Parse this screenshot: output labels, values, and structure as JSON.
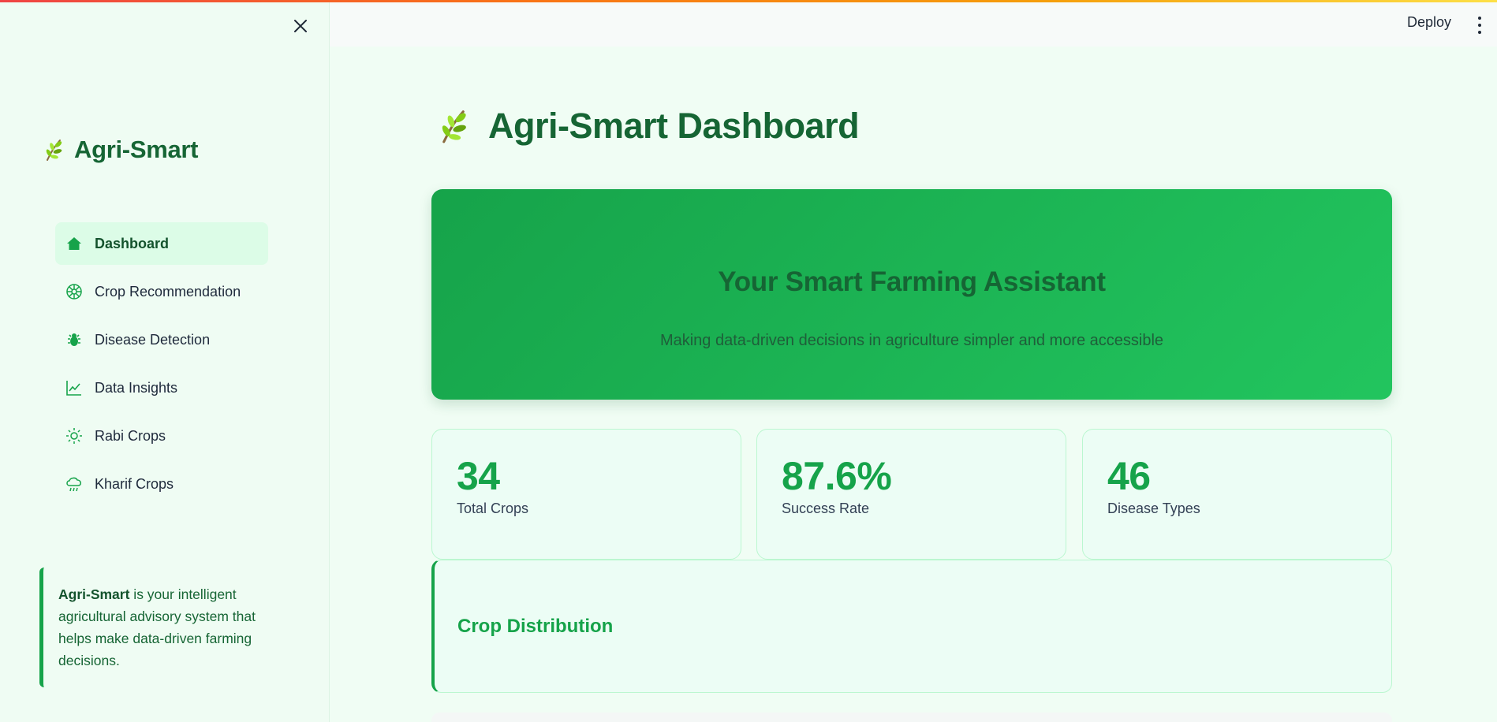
{
  "app": {
    "name": "Agri-Smart"
  },
  "header": {
    "deploy_label": "Deploy"
  },
  "sidebar": {
    "brand": "Agri-Smart",
    "items": [
      {
        "label": "Dashboard",
        "icon": "home-icon",
        "active": true
      },
      {
        "label": "Crop Recommendation",
        "icon": "flower-icon",
        "active": false
      },
      {
        "label": "Disease Detection",
        "icon": "bug-icon",
        "active": false
      },
      {
        "label": "Data Insights",
        "icon": "line-chart-icon",
        "active": false
      },
      {
        "label": "Rabi Crops",
        "icon": "sun-icon",
        "active": false
      },
      {
        "label": "Kharif Crops",
        "icon": "cloud-rain-icon",
        "active": false
      }
    ],
    "about": {
      "name": "Agri-Smart",
      "text": " is your intelligent agricultural advisory system that helps make data-driven farming decisions."
    }
  },
  "main": {
    "title": "Agri-Smart Dashboard",
    "hero": {
      "title": "Your Smart Farming Assistant",
      "subtitle": "Making data-driven decisions in agriculture simpler and more accessible"
    },
    "stats": [
      {
        "value": "34",
        "label": "Total Crops"
      },
      {
        "value": "87.6%",
        "label": "Success Rate"
      },
      {
        "value": "46",
        "label": "Disease Types"
      }
    ],
    "distribution": {
      "title": "Crop Distribution"
    }
  },
  "colors": {
    "primary": "#16a34a",
    "dark_green": "#166534",
    "light_bg": "#f0fdf4",
    "active_nav": "#dcfce7",
    "card_border": "#bbf7d0"
  }
}
